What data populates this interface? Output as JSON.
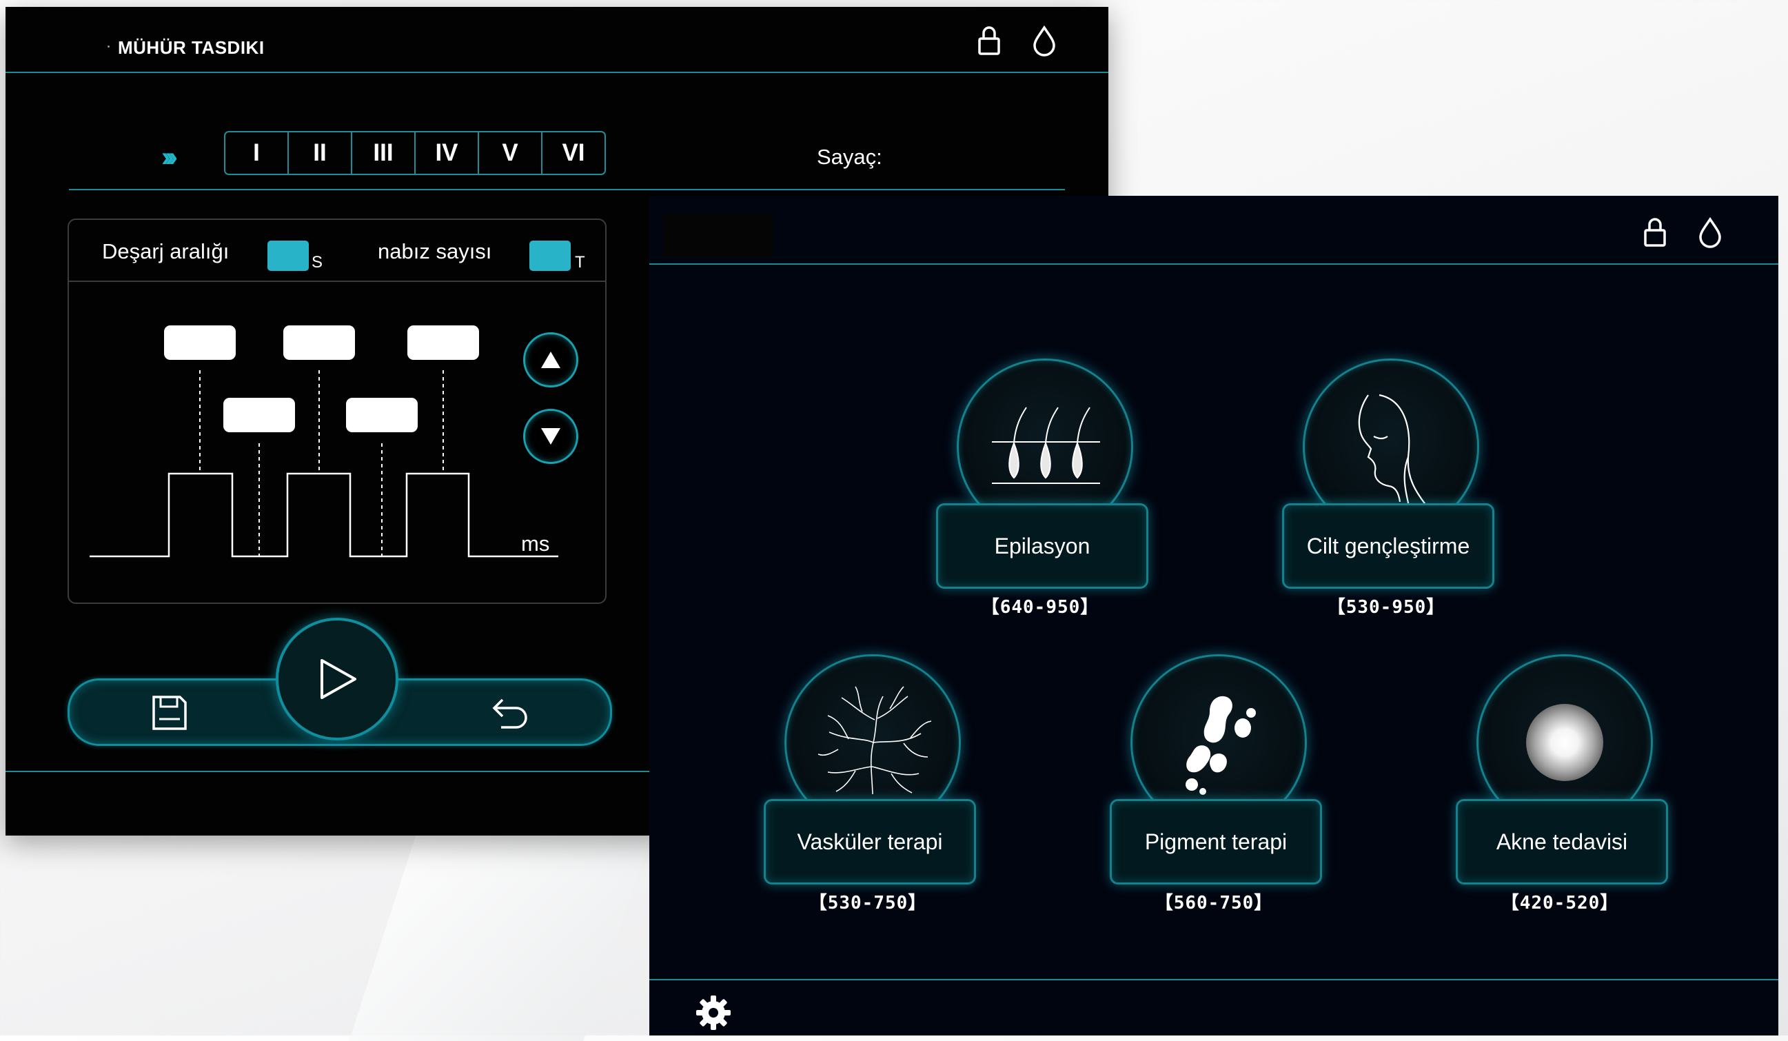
{
  "settings_screen": {
    "title": "MÜHÜR TASDIKI",
    "header_icons": [
      "lock-icon",
      "water-drop-icon"
    ],
    "tabs_arrow_icon": "triple-chevron-icon",
    "tabs": [
      "I",
      "II",
      "III",
      "IV",
      "V",
      "VI"
    ],
    "counter_label": "Sayaç:",
    "discharge_label": "Deşarj aralığı",
    "discharge_unit": "S",
    "pulse_count_label": "nabız sayısı",
    "pulse_count_unit": "T",
    "time_unit": "ms",
    "colors": {
      "accent": "#1b8c97",
      "swatch": "#29b3c8",
      "background": "#020202"
    },
    "controls": [
      "up-arrow-icon",
      "down-arrow-icon",
      "save-icon",
      "play-icon",
      "undo-icon"
    ]
  },
  "mode_screen": {
    "header_icons": [
      "lock-icon",
      "water-drop-icon"
    ],
    "modes": [
      {
        "name": "Epilasyon",
        "range": "【640-950】",
        "icon": "hair-follicle-icon"
      },
      {
        "name": "Cilt gençleştirme",
        "range": "【530-950】",
        "icon": "face-profile-icon"
      },
      {
        "name": "Vasküler terapi",
        "range": "【530-750】",
        "icon": "blood-vessel-icon"
      },
      {
        "name": "Pigment terapi",
        "range": "【560-750】",
        "icon": "pigment-spots-icon"
      },
      {
        "name": "Akne tedavisi",
        "range": "【420-520】",
        "icon": "acne-spot-icon"
      }
    ],
    "footer_icon": "gear-icon",
    "colors": {
      "accent": "#14818e",
      "background": "#010510"
    }
  }
}
